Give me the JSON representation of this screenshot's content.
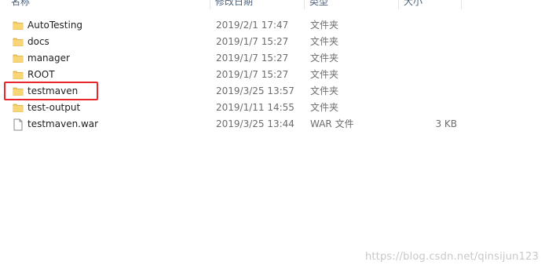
{
  "header": {
    "name": "名称",
    "date": "修改日期",
    "type": "类型",
    "size": "大小"
  },
  "files": [
    {
      "name": "AutoTesting",
      "date": "2019/2/1 17:47",
      "type": "文件夹",
      "size": "",
      "icon": "folder-icon"
    },
    {
      "name": "docs",
      "date": "2019/1/7 15:27",
      "type": "文件夹",
      "size": "",
      "icon": "folder-icon"
    },
    {
      "name": "manager",
      "date": "2019/1/7 15:27",
      "type": "文件夹",
      "size": "",
      "icon": "folder-icon"
    },
    {
      "name": "ROOT",
      "date": "2019/1/7 15:27",
      "type": "文件夹",
      "size": "",
      "icon": "folder-icon"
    },
    {
      "name": "testmaven",
      "date": "2019/3/25 13:57",
      "type": "文件夹",
      "size": "",
      "icon": "folder-icon"
    },
    {
      "name": "test-output",
      "date": "2019/1/11 14:55",
      "type": "文件夹",
      "size": "",
      "icon": "folder-icon"
    },
    {
      "name": "testmaven.war",
      "date": "2019/3/25 13:44",
      "type": "WAR 文件",
      "size": "3 KB",
      "icon": "file-icon"
    }
  ],
  "watermark": "https://blog.csdn.net/qinsijun123",
  "colors": {
    "folder": "#f4c85a",
    "highlight": "#e8262c"
  }
}
